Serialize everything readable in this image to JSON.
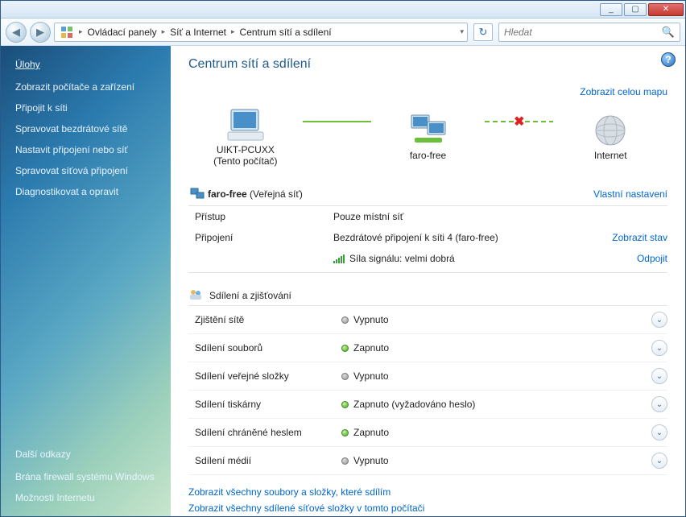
{
  "titlebar": {
    "min": "_",
    "max": "▢",
    "close": "✕"
  },
  "nav": {
    "back": "◀",
    "fwd": "▶",
    "crumbs": [
      "Ovládací panely",
      "Síť a Internet",
      "Centrum sítí a sdílení"
    ],
    "refresh": "↻"
  },
  "search": {
    "placeholder": "Hledat"
  },
  "sidebar": {
    "tasks_heading": "Úlohy",
    "items": [
      "Zobrazit počítače a zařízení",
      "Připojit k síti",
      "Spravovat bezdrátové sítě",
      "Nastavit připojení nebo síť",
      "Spravovat síťová připojení",
      "Diagnostikovat a opravit"
    ],
    "also_heading": "Další odkazy",
    "also": [
      "Brána firewall systému Windows",
      "Možnosti Internetu"
    ]
  },
  "page": {
    "title": "Centrum sítí a sdílení",
    "view_map": "Zobrazit celou mapu",
    "node_pc": "UIKT-PCUXX",
    "node_pc_sub": "(Tento počítač)",
    "node_net": "faro-free",
    "node_internet": "Internet"
  },
  "network": {
    "name": "faro-free",
    "type": "(Veřejná síť)",
    "customize": "Vlastní nastavení",
    "rows": {
      "access_k": "Přístup",
      "access_v": "Pouze místní síť",
      "conn_k": "Připojení",
      "conn_v": "Bezdrátové připojení k síti 4 (faro-free)",
      "conn_link": "Zobrazit stav",
      "signal_label": "Síla signálu: velmi dobrá",
      "disconnect": "Odpojit"
    }
  },
  "sharing": {
    "heading": "Sdílení a zjišťování",
    "rows": [
      {
        "k": "Zjištění sítě",
        "v": "Vypnuto",
        "on": false
      },
      {
        "k": "Sdílení souborů",
        "v": "Zapnuto",
        "on": true
      },
      {
        "k": "Sdílení veřejné složky",
        "v": "Vypnuto",
        "on": false
      },
      {
        "k": "Sdílení tiskárny",
        "v": "Zapnuto (vyžadováno heslo)",
        "on": true
      },
      {
        "k": "Sdílení chráněné heslem",
        "v": "Zapnuto",
        "on": true
      },
      {
        "k": "Sdílení médií",
        "v": "Vypnuto",
        "on": false
      }
    ]
  },
  "bottom": {
    "link1": "Zobrazit všechny soubory a složky, které sdílím",
    "link2": "Zobrazit všechny sdílené síťové složky v tomto počítači"
  }
}
